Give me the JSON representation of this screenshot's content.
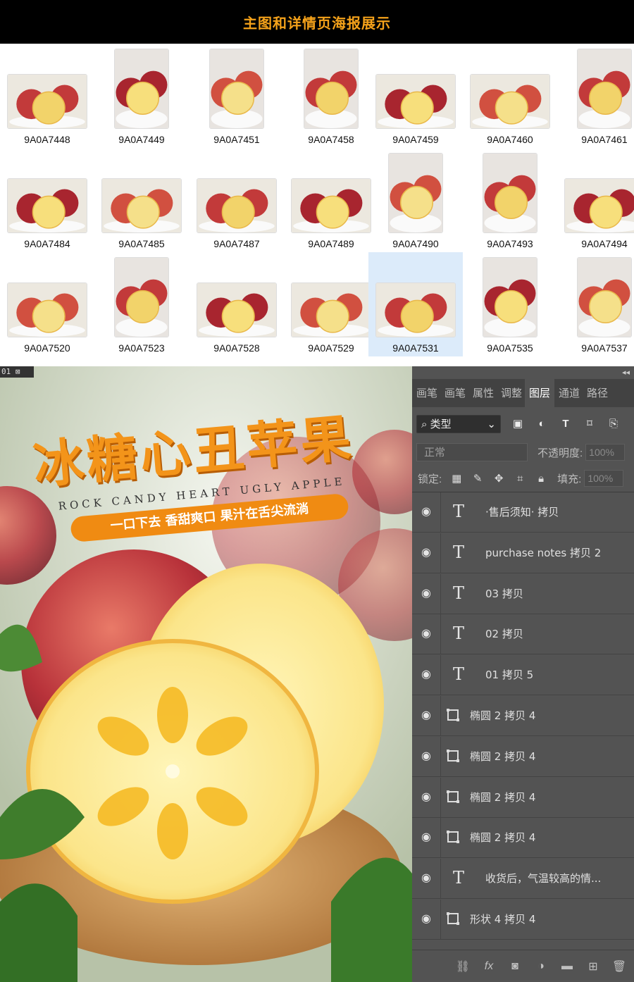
{
  "header": {
    "title": "主图和详情页海报展示"
  },
  "thumbnails": [
    {
      "label": "9A0A7448",
      "orientation": "landscape"
    },
    {
      "label": "9A0A7449",
      "orientation": "portrait"
    },
    {
      "label": "9A0A7451",
      "orientation": "portrait"
    },
    {
      "label": "9A0A7458",
      "orientation": "portrait"
    },
    {
      "label": "9A0A7459",
      "orientation": "landscape"
    },
    {
      "label": "9A0A7460",
      "orientation": "landscape"
    },
    {
      "label": "9A0A7461",
      "orientation": "portrait"
    },
    {
      "label": "9A0A7484",
      "orientation": "landscape"
    },
    {
      "label": "9A0A7485",
      "orientation": "landscape"
    },
    {
      "label": "9A0A7487",
      "orientation": "landscape"
    },
    {
      "label": "9A0A7489",
      "orientation": "landscape"
    },
    {
      "label": "9A0A7490",
      "orientation": "portrait"
    },
    {
      "label": "9A0A7493",
      "orientation": "portrait"
    },
    {
      "label": "9A0A7494",
      "orientation": "landscape"
    },
    {
      "label": "9A0A7520",
      "orientation": "landscape"
    },
    {
      "label": "9A0A7523",
      "orientation": "portrait"
    },
    {
      "label": "9A0A7528",
      "orientation": "landscape"
    },
    {
      "label": "9A0A7529",
      "orientation": "landscape"
    },
    {
      "label": "9A0A7531",
      "orientation": "landscape",
      "selected": true
    },
    {
      "label": "9A0A7535",
      "orientation": "portrait"
    },
    {
      "label": "9A0A7537",
      "orientation": "portrait"
    }
  ],
  "document": {
    "tab_label": "01"
  },
  "poster": {
    "title": "冰糖心丑苹果",
    "subtitle": "ROCK CANDY HEART UGLY APPLE",
    "slogan": "一口下去  香甜爽口  果汁在舌尖流淌"
  },
  "panel": {
    "tabs": [
      "画笔",
      "画笔",
      "属性",
      "调整",
      "图层",
      "通道",
      "路径"
    ],
    "active_tab": "图层",
    "filter_kind": "类型",
    "blend_mode": "正常",
    "opacity_label": "不透明度:",
    "opacity_value": "100%",
    "lock_label": "锁定:",
    "fill_label": "填充:",
    "fill_value": "100%",
    "layers": [
      {
        "type": "text",
        "name": "·售后须知· 拷贝"
      },
      {
        "type": "text",
        "name": "purchase notes 拷贝 2"
      },
      {
        "type": "text",
        "name": "03 拷贝"
      },
      {
        "type": "text",
        "name": "02 拷贝"
      },
      {
        "type": "text",
        "name": "01 拷贝 5"
      },
      {
        "type": "shape",
        "name": "椭圆 2 拷贝 4"
      },
      {
        "type": "shape",
        "name": "椭圆 2 拷贝 4"
      },
      {
        "type": "shape",
        "name": "椭圆 2 拷贝 4"
      },
      {
        "type": "shape",
        "name": "椭圆 2 拷贝 4"
      },
      {
        "type": "text",
        "name": "收货后，气温较高的情..."
      },
      {
        "type": "shape",
        "name": "形状 4 拷贝 4"
      }
    ],
    "footer_icons": [
      "link-icon",
      "fx-icon",
      "mask-icon",
      "adjustment-icon",
      "folder-icon",
      "new-layer-icon",
      "trash-icon"
    ]
  },
  "colors": {
    "accent": "#f3941a",
    "panel": "#535353",
    "panel_dark": "#424242",
    "selection": "#dcebfa"
  }
}
